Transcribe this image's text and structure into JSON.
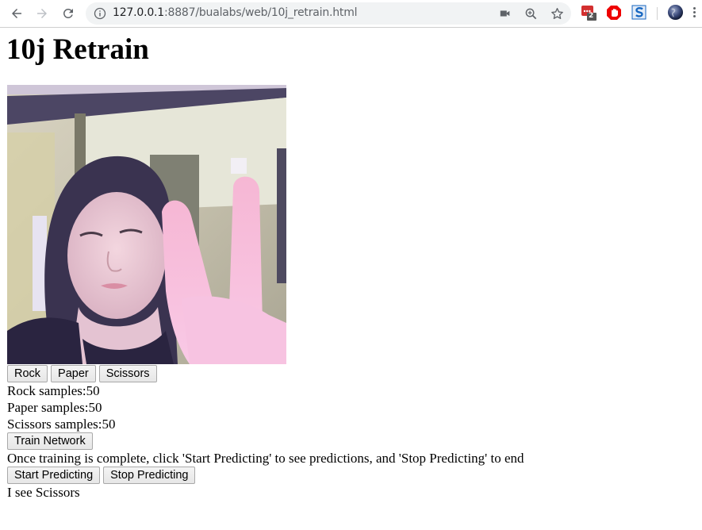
{
  "browser": {
    "url_host": "127.0.0.1",
    "url_rest": ":8887/bualabs/web/10j_retrain.html",
    "extension_badge_count": "2",
    "colors": {
      "ext_red": "#d32f2f",
      "ext_blue": "#1565c0"
    }
  },
  "page": {
    "title": "10j Retrain",
    "webcam_alt": "webcam video feed",
    "sample_buttons": [
      "Rock",
      "Paper",
      "Scissors"
    ],
    "samples": [
      {
        "label": "Rock samples:",
        "count": "50"
      },
      {
        "label": "Paper samples:",
        "count": "50"
      },
      {
        "label": "Scissors samples:",
        "count": "50"
      }
    ],
    "train_button": "Train Network",
    "instructions": "Once training is complete, click 'Start Predicting' to see predictions, and 'Stop Predicting' to end",
    "start_button": "Start Predicting",
    "stop_button": "Stop Predicting",
    "prediction": "I see Scissors"
  }
}
